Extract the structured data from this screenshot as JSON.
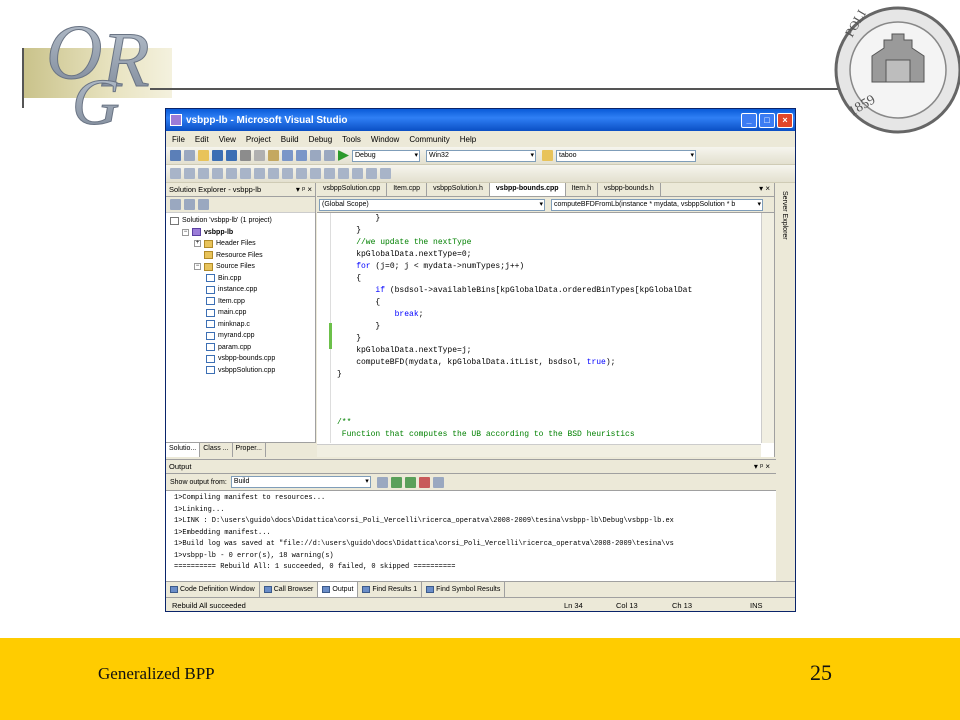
{
  "vs": {
    "title": "vsbpp-lb - Microsoft Visual Studio",
    "menu": [
      "File",
      "Edit",
      "View",
      "Project",
      "Build",
      "Debug",
      "Tools",
      "Window",
      "Community",
      "Help"
    ],
    "toolbar": {
      "config": "Debug",
      "platform": "Win32",
      "find": "taboo"
    },
    "solution_explorer": {
      "title": "Solution Explorer - vsbpp-lb",
      "tree": [
        {
          "label": "Solution 'vsbpp-lb' (1 project)",
          "type": "sol",
          "level": 0
        },
        {
          "label": "vsbpp-lb",
          "type": "proj",
          "level": 1
        },
        {
          "label": "Header Files",
          "type": "folder",
          "level": 2
        },
        {
          "label": "Resource Files",
          "type": "folder",
          "level": 2
        },
        {
          "label": "Source Files",
          "type": "folder",
          "level": 2
        },
        {
          "label": "Bin.cpp",
          "type": "file",
          "level": 3
        },
        {
          "label": "instance.cpp",
          "type": "file",
          "level": 3
        },
        {
          "label": "Item.cpp",
          "type": "file",
          "level": 3
        },
        {
          "label": "main.cpp",
          "type": "file",
          "level": 3
        },
        {
          "label": "minknap.c",
          "type": "file",
          "level": 3
        },
        {
          "label": "myrand.cpp",
          "type": "file",
          "level": 3
        },
        {
          "label": "param.cpp",
          "type": "file",
          "level": 3
        },
        {
          "label": "vsbpp-bounds.cpp",
          "type": "file",
          "level": 3
        },
        {
          "label": "vsbppSolution.cpp",
          "type": "file",
          "level": 3
        }
      ],
      "bottom_tabs": [
        "Solutio...",
        "Class ...",
        "Proper..."
      ]
    },
    "editor": {
      "tabs": [
        "vsbppSolution.cpp",
        "Item.cpp",
        "vsbppSolution.h",
        "vsbpp-bounds.cpp",
        "Item.h",
        "vsbpp-bounds.h"
      ],
      "active_tab": "vsbpp-bounds.cpp",
      "scope": "(Global Scope)",
      "function": "computeBFDFromLb(instance * mydata, vsbppSolution * b",
      "code": [
        "        }",
        "    }",
        "    //we update the nextType",
        "    kpGlobalData.nextType=0;",
        "    for (j=0; j < mydata->numTypes;j++)",
        "    {",
        "        if (bsdsol->availableBins[kpGlobalData.orderedBinTypes[kpGlobalDat",
        "        {",
        "            break;",
        "        }",
        "    }",
        "    kpGlobalData.nextType=j;",
        "    computeBFD(mydata, kpGlobalData.itList, bsdsol, true);",
        "}",
        "",
        "",
        "",
        "/**",
        " Function that computes the UB according to the BSD heuristics"
      ]
    },
    "server_explorer": "Server Explorer",
    "output": {
      "title": "Output",
      "show_from_label": "Show output from:",
      "show_from_value": "Build",
      "lines": [
        "1>Compiling manifest to resources...",
        "1>Linking...",
        "1>LINK : D:\\users\\guido\\docs\\Didattica\\corsi_Poli_Vercelli\\ricerca_operatva\\2008-2009\\tesina\\vsbpp-lb\\Debug\\vsbpp-lb.ex",
        "1>Embedding manifest...",
        "1>Build log was saved at \"file://d:\\users\\guido\\docs\\Didattica\\corsi_Poli_Vercelli\\ricerca_operatva\\2008-2009\\tesina\\vs",
        "1>vsbpp-lb - 0 error(s), 18 warning(s)",
        "========== Rebuild All: 1 succeeded, 0 failed, 0 skipped =========="
      ]
    },
    "output_tabs": [
      "Code Definition Window",
      "Call Browser",
      "Output",
      "Find Results 1",
      "Find Symbol Results"
    ],
    "status": {
      "message": "Rebuild All succeeded",
      "ln": "Ln 34",
      "col": "Col 13",
      "ch": "Ch 13",
      "mode": "INS"
    }
  },
  "footer": {
    "title": "Generalized BPP",
    "page": "25"
  },
  "colors": {
    "footer": "#ffcc00",
    "vs_title": "#0a5bd8",
    "keyword": "#0000ff",
    "comment": "#008000"
  }
}
